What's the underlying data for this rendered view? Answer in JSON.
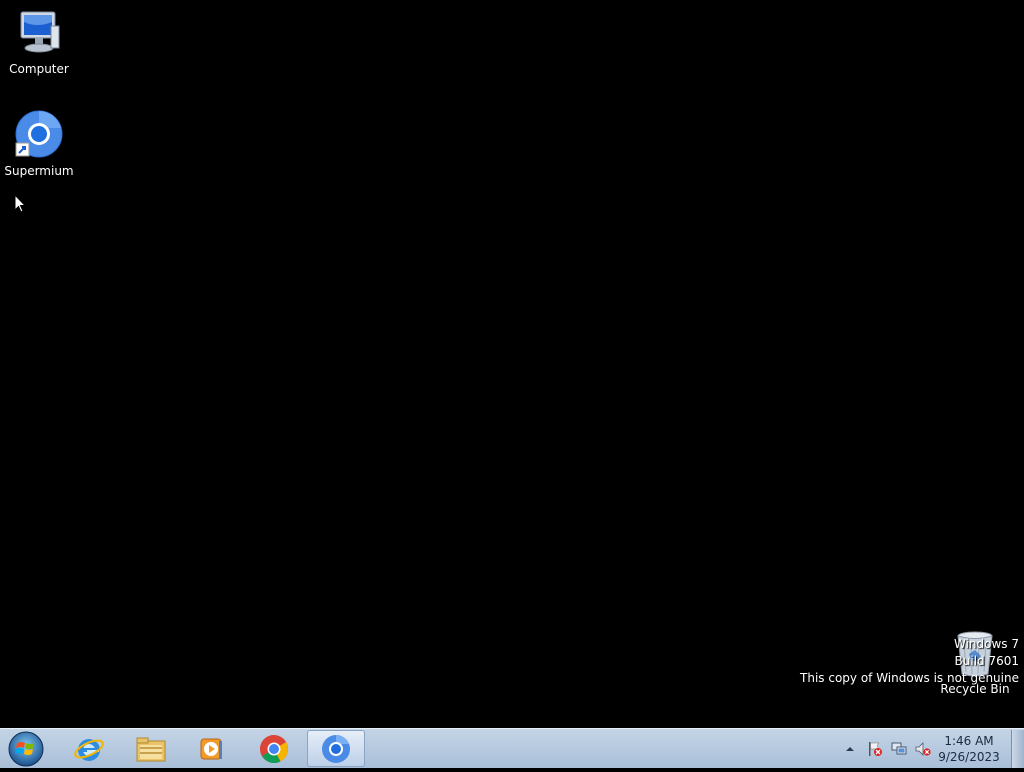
{
  "desktop": {
    "icons": [
      {
        "label": "Computer",
        "icon": "computer-icon"
      },
      {
        "label": "Supermium",
        "icon": "supermium-icon"
      },
      {
        "label": "Recycle Bin",
        "icon": "recycle-bin-icon"
      }
    ],
    "watermark": {
      "line1": "Windows 7",
      "line2": "Build 7601",
      "line3": "This copy of Windows is not genuine"
    }
  },
  "taskbar": {
    "pinned": [
      {
        "name": "internet-explorer",
        "icon": "internet-explorer-icon"
      },
      {
        "name": "windows-explorer",
        "icon": "folder-icon"
      },
      {
        "name": "windows-media-player",
        "icon": "media-player-icon"
      },
      {
        "name": "google-chrome",
        "icon": "chrome-icon"
      },
      {
        "name": "supermium",
        "icon": "supermium-icon",
        "active": true
      }
    ],
    "tray": {
      "icons": [
        "show-hidden-icons-arrow",
        "action-center-flag-icon",
        "network-icon",
        "volume-muted-icon"
      ]
    },
    "clock": {
      "time": "1:46 AM",
      "date": "9/26/2023"
    }
  },
  "colors": {
    "desktop_background": "#000000",
    "taskbar": "#b4c6dc",
    "text": "#ffffff"
  }
}
